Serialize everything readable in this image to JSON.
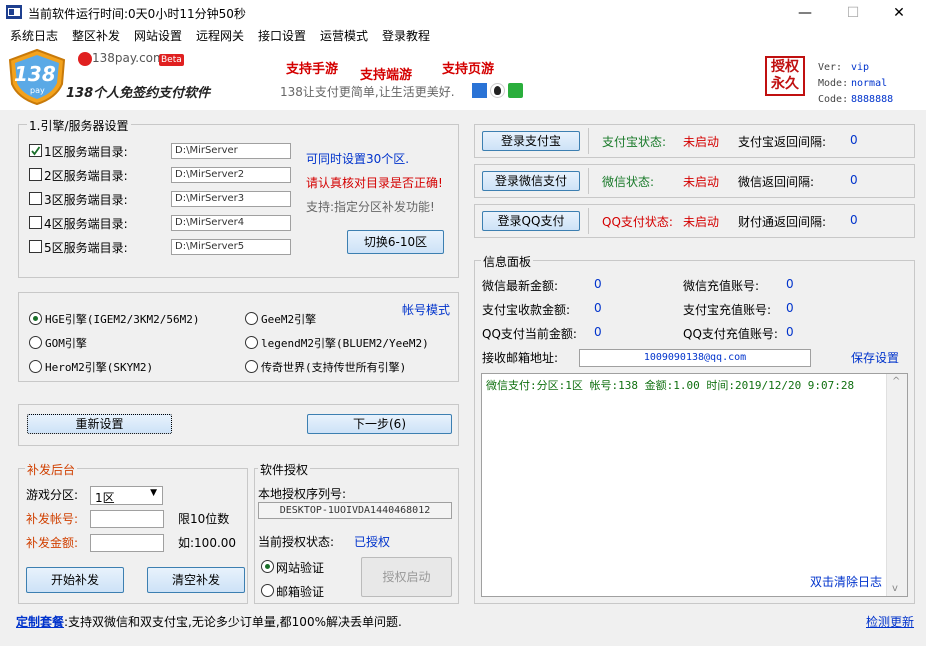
{
  "window": {
    "title": "当前软件运行时间:0天0小时11分钟50秒",
    "minimize": "—",
    "maximize": "☐",
    "close": "✕"
  },
  "menu": [
    "系统日志",
    "整区补发",
    "网站设置",
    "远程网关",
    "接口设置",
    "运营模式",
    "登录教程"
  ],
  "header": {
    "logo_text": "138",
    "logo_sub": "pay",
    "brand_site": "138pay.com",
    "beta": "Beta",
    "tagline": "138个人免签约支付软件",
    "promo1": "支持手游",
    "promo2": "支持端游",
    "promo3": "支持页游",
    "slogan": "138让支付更简单,让生活更美好.",
    "seal": "授权永久",
    "ver_label": "Ver:",
    "ver_value": "vip",
    "mode_label": "Mode:",
    "mode_value": "normal",
    "code_label": "Code:",
    "code_value": "8888888"
  },
  "engine": {
    "title": "1.引擎/服务器设置",
    "servers": [
      {
        "label": "1区服务端目录:",
        "path": "D:\\MirServer",
        "checked": true
      },
      {
        "label": "2区服务端目录:",
        "path": "D:\\MirServer2",
        "checked": false
      },
      {
        "label": "3区服务端目录:",
        "path": "D:\\MirServer3",
        "checked": false
      },
      {
        "label": "4区服务端目录:",
        "path": "D:\\MirServer4",
        "checked": false
      },
      {
        "label": "5区服务端目录:",
        "path": "D:\\MirServer5",
        "checked": false
      }
    ],
    "note1": "可同时设置30个区.",
    "note2": "请认真核对目录是否正确!",
    "note3": "支持:指定分区补发功能!",
    "switch_btn": "切换6-10区"
  },
  "engines": {
    "mode_label": "帐号模式",
    "options": [
      {
        "label": "HGE引擎(IGEM2/3KM2/56M2)",
        "selected": true
      },
      {
        "label": "GeeM2引擎",
        "selected": false
      },
      {
        "label": "GOM引擎",
        "selected": false
      },
      {
        "label": "legendM2引擎(BLUEM2/YeeM2)",
        "selected": false
      },
      {
        "label": "HeroM2引擎(SKYM2)",
        "selected": false
      },
      {
        "label": "传奇世界(支持传世所有引擎)",
        "selected": false
      }
    ]
  },
  "actions": {
    "reset": "重新设置",
    "next": "下一步(6)"
  },
  "reissue": {
    "title": "补发后台",
    "zone_label": "游戏分区:",
    "zone_value": "1区",
    "account_label": "补发帐号:",
    "account_hint": "限10位数",
    "amount_label": "补发金额:",
    "amount_hint": "如:100.00",
    "start_btn": "开始补发",
    "clear_btn": "清空补发"
  },
  "license": {
    "title": "软件授权",
    "serial_label": "本地授权序列号:",
    "serial_value": "DESKTOP-1UOIVDA1440468012",
    "status_label": "当前授权状态:",
    "status_value": "已授权",
    "verify_site": "网站验证",
    "verify_mail": "邮箱验证",
    "start_btn": "授权启动"
  },
  "payments": [
    {
      "button": "登录支付宝",
      "status_label": "支付宝状态:",
      "status_value": "未启动",
      "interval_label": "支付宝返回间隔:",
      "interval_value": "0"
    },
    {
      "button": "登录微信支付",
      "status_label": "微信状态:",
      "status_value": "未启动",
      "interval_label": "微信返回间隔:",
      "interval_value": "0"
    },
    {
      "button": "登录QQ支付",
      "status_label": "QQ支付状态:",
      "status_value": "未启动",
      "interval_label": "财付通返回间隔:",
      "interval_value": "0"
    }
  ],
  "info": {
    "title": "信息面板",
    "wx_amount_label": "微信最新金额:",
    "wx_amount": "0",
    "wx_acct_label": "微信充值账号:",
    "wx_acct": "0",
    "ali_amount_label": "支付宝收款金额:",
    "ali_amount": "0",
    "ali_acct_label": "支付宝充值账号:",
    "ali_acct": "0",
    "qq_amount_label": "QQ支付当前金额:",
    "qq_amount": "0",
    "qq_acct_label": "QQ支付充值账号:",
    "qq_acct": "0",
    "email_label": "接收邮箱地址:",
    "email_value": "1009090138@qq.com",
    "save_btn": "保存设置",
    "log_line": "微信支付:分区:1区 帐号:138 金额:1.00 时间:2019/12/20 9:07:28",
    "clear_log": "双击清除日志"
  },
  "footer": {
    "custom_label": "定制套餐",
    "custom_text": ":支持双微信和双支付宝,无论多少订单量,都100%解决丢单问题.",
    "update": "检测更新"
  },
  "colors": {
    "accent_red": "#d40000",
    "link_blue": "#0033cc",
    "log_green": "#107010"
  }
}
